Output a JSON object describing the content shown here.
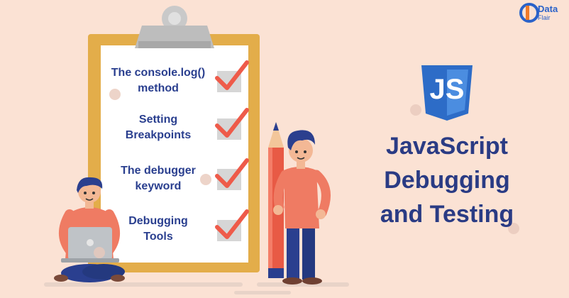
{
  "checklist": {
    "items": [
      {
        "line1": "The console.log()",
        "line2": "method"
      },
      {
        "line1": "Setting",
        "line2": "Breakpoints"
      },
      {
        "line1": "The debugger",
        "line2": "keyword"
      },
      {
        "line1": "Debugging",
        "line2": "Tools"
      }
    ]
  },
  "title": {
    "line1": "JavaScript",
    "line2": "Debugging",
    "line3": "and Testing"
  },
  "badge": {
    "text": "JS",
    "icon": "javascript-shield-icon"
  },
  "brand": {
    "line1": "Data",
    "line2": "Flair",
    "icon": "dataflair-logo-icon"
  },
  "colors": {
    "background": "#fbe2d4",
    "clipboard": "#e3ad4a",
    "title": "#2a3b84",
    "check": "#ee5b4a",
    "js_shield": "#2d6cc7"
  }
}
